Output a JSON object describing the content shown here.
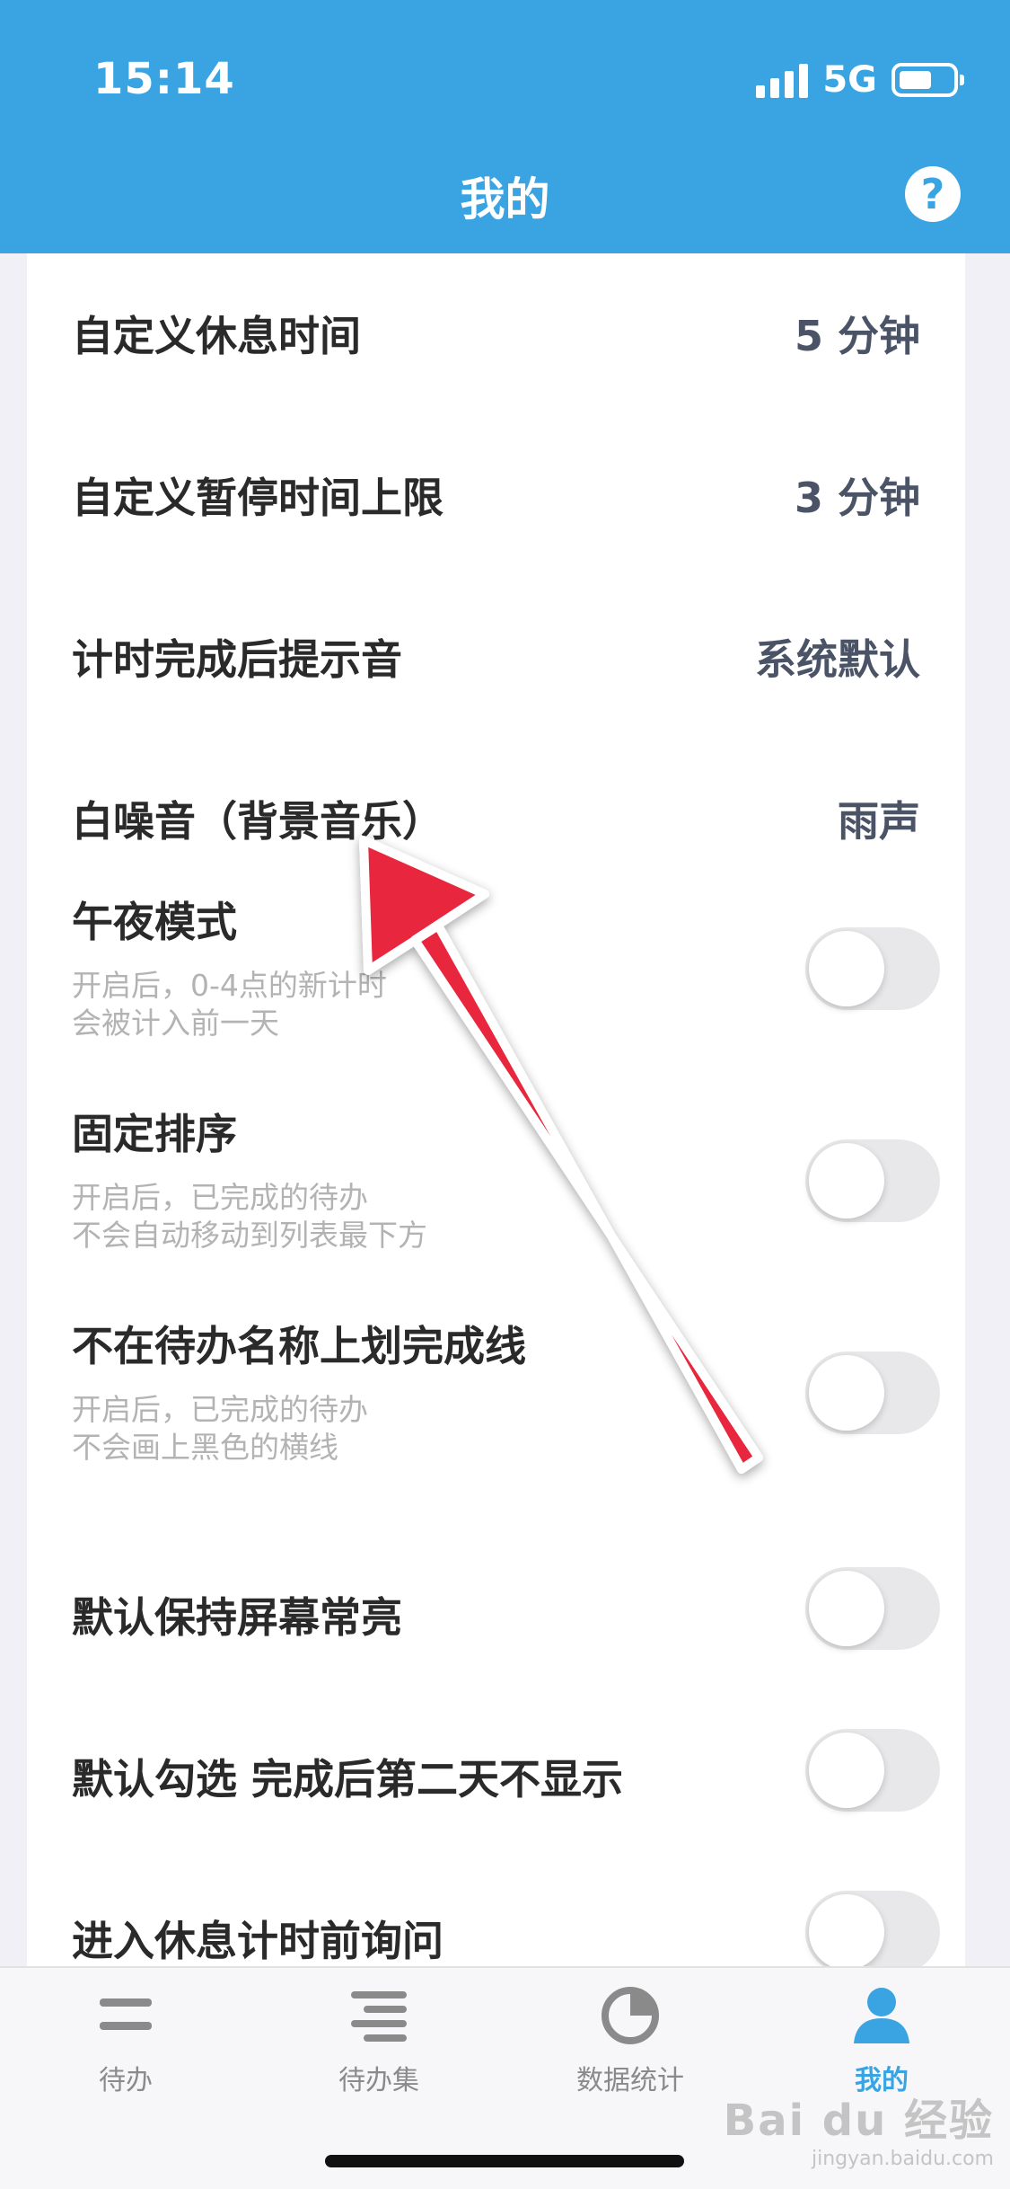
{
  "status_bar": {
    "time": "15:14",
    "network": "5G"
  },
  "header": {
    "title": "我的",
    "help_icon": "question-circle-icon",
    "help_glyph": "?"
  },
  "settings": [
    {
      "label": "自定义休息时间",
      "value": "5 分钟"
    },
    {
      "label": "自定义暂停时间上限",
      "value": "3 分钟"
    },
    {
      "label": "计时完成后提示音",
      "value": "系统默认"
    },
    {
      "label": "白噪音（背景音乐）",
      "value": "雨声"
    }
  ],
  "toggles": [
    {
      "label": "午夜模式",
      "desc1": "开启后，0-4点的新计时",
      "desc2": "会被计入前一天",
      "on": false
    },
    {
      "label": "固定排序",
      "desc1": "开启后，已完成的待办",
      "desc2": "不会自动移动到列表最下方",
      "on": false
    },
    {
      "label": "不在待办名称上划完成线",
      "desc1": "开启后，已完成的待办",
      "desc2": "不会画上黑色的横线",
      "on": false
    },
    {
      "label": "默认保持屏幕常亮",
      "on": false
    },
    {
      "label": "默认勾选 完成后第二天不显示",
      "on": false
    },
    {
      "label": "进入休息计时前询问",
      "on": false
    }
  ],
  "tabs": [
    {
      "label": "待办",
      "icon": "list-icon",
      "active": false
    },
    {
      "label": "待办集",
      "icon": "list-set-icon",
      "active": false
    },
    {
      "label": "数据统计",
      "icon": "pie-chart-icon",
      "active": false
    },
    {
      "label": "我的",
      "icon": "user-icon",
      "active": true
    }
  ],
  "watermark": {
    "main": "Bai du 经验",
    "sub": "jingyan.baidu.com"
  },
  "colors": {
    "accent": "#3aa4e2",
    "arrow": "#e8283c",
    "toggle_off": "#e8e8ea"
  }
}
